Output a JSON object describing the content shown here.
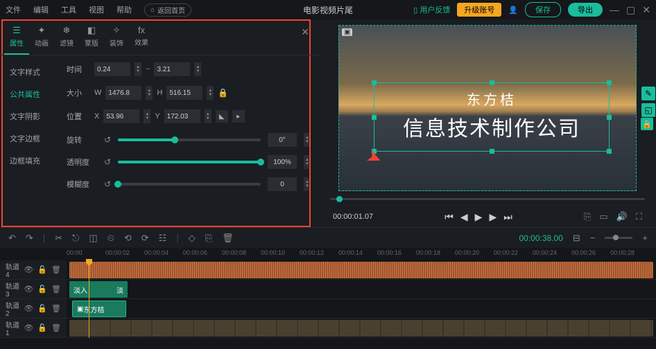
{
  "topbar": {
    "menus": [
      "文件",
      "编辑",
      "工具",
      "视图",
      "帮助"
    ],
    "back_home": "返回首页",
    "title": "电影视频片尾",
    "feedback": "用户反馈",
    "upgrade": "升级账号",
    "save": "保存",
    "export": "导出"
  },
  "tabs": [
    {
      "label": "属性",
      "icon": "☰"
    },
    {
      "label": "动画",
      "icon": "✦"
    },
    {
      "label": "滤镜",
      "icon": "❄"
    },
    {
      "label": "蒙版",
      "icon": "◧"
    },
    {
      "label": "装饰",
      "icon": "✧"
    },
    {
      "label": "效果",
      "icon": "fx"
    }
  ],
  "subnav": [
    "文字样式",
    "公共属性",
    "文字阴影",
    "文字边框",
    "边框填充"
  ],
  "props": {
    "time_label": "时间",
    "time_start": "0.24",
    "time_end": "3.21",
    "size_label": "大小",
    "size_w_label": "W",
    "size_w": "1476.8",
    "size_h_label": "H",
    "size_h": "516.15",
    "pos_label": "位置",
    "pos_x_label": "X",
    "pos_x": "53.96",
    "pos_y_label": "Y",
    "pos_y": "172.03",
    "rotate_label": "旋转",
    "rotate_val": "0°",
    "rotate_pct": 40,
    "opacity_label": "透明度",
    "opacity_val": "100%",
    "opacity_pct": 100,
    "blur_label": "模糊度",
    "blur_val": "0",
    "blur_pct": 0
  },
  "preview": {
    "text1": "东方桔",
    "text2": "信息技术制作公司"
  },
  "playbar": {
    "current": "00:00:01.07",
    "total": "00:00:38.00"
  },
  "ruler": [
    "00:00",
    "00:00:02",
    "00:00:04",
    "00:00:06",
    "00:00:08",
    "00:00:10",
    "00:00:12",
    "00:00:14",
    "00:00:16",
    "00:00:18",
    "00:00:20",
    "00:00:22",
    "00:00:24",
    "00:00:26",
    "00:00:28"
  ],
  "tracks": {
    "t4": "轨道4",
    "t3": "轨道3",
    "t2": "轨道2",
    "t1": "轨道1",
    "clip_in": "淡入",
    "clip_out": "淡",
    "clip_title": "东方桔"
  }
}
